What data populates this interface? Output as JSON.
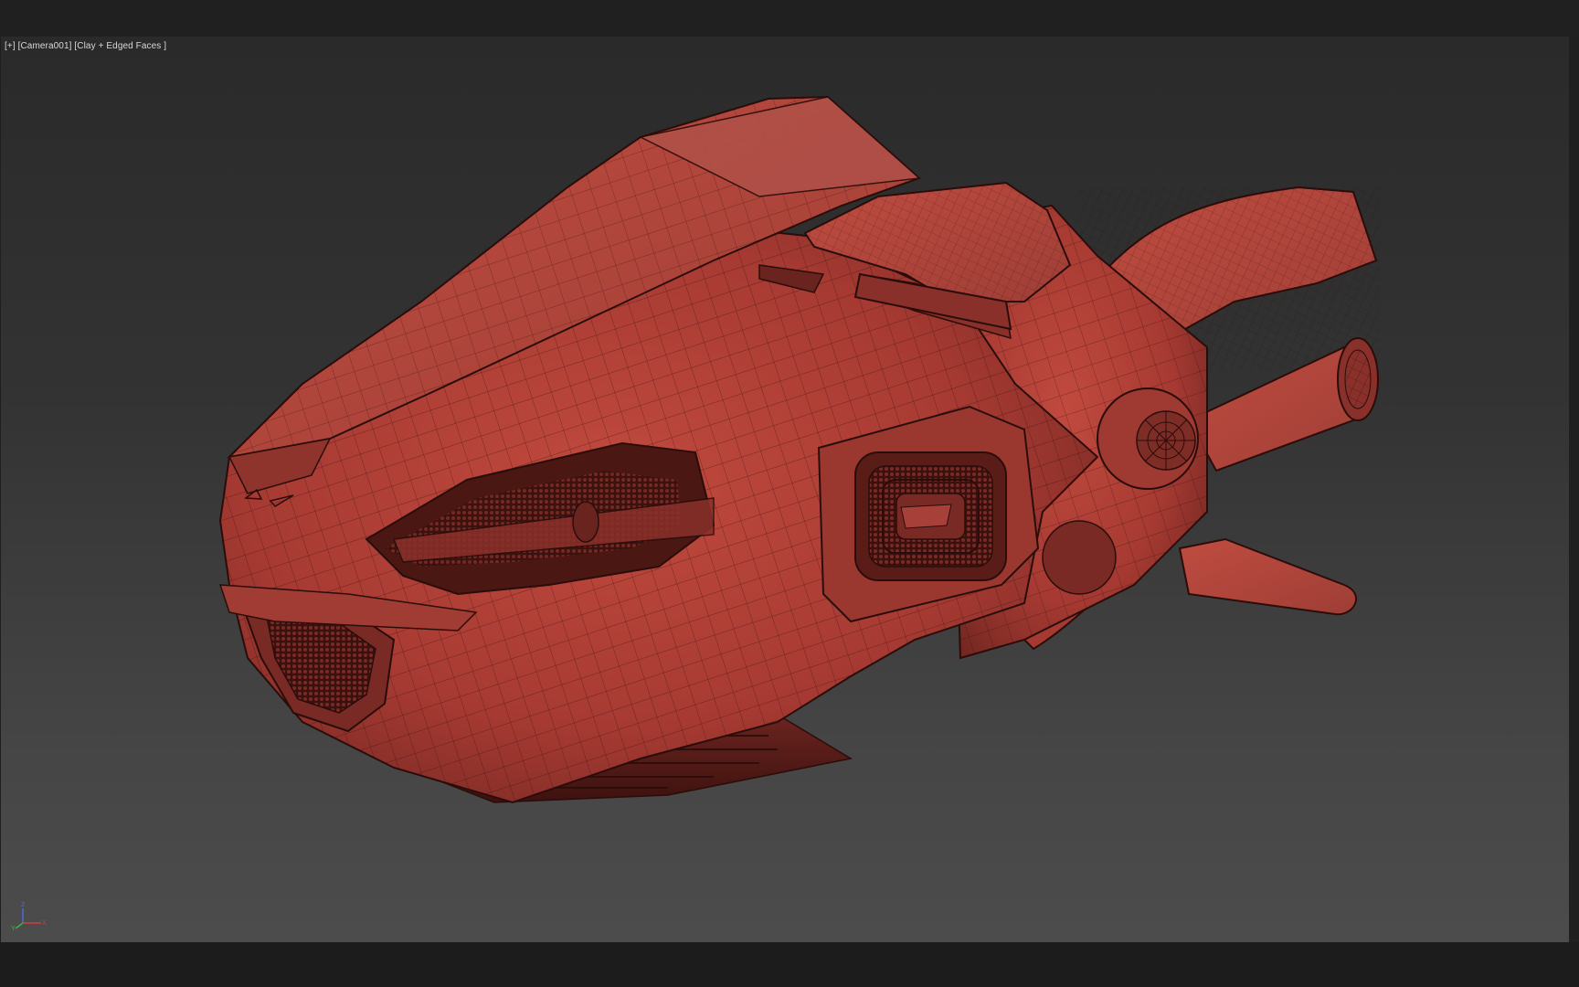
{
  "viewport": {
    "label_menu": "[+]",
    "label_camera": "[Camera001]",
    "label_shading": "[Clay + Edged Faces ]"
  },
  "axis_gizmo": {
    "z": "Z",
    "x": "X",
    "y": "Y",
    "colors": {
      "x": "#d83a3a",
      "y": "#3ab33a",
      "z": "#4a6be0"
    }
  },
  "model": {
    "material_color": "#b8443a",
    "wire_color": "#2a0d0a"
  }
}
